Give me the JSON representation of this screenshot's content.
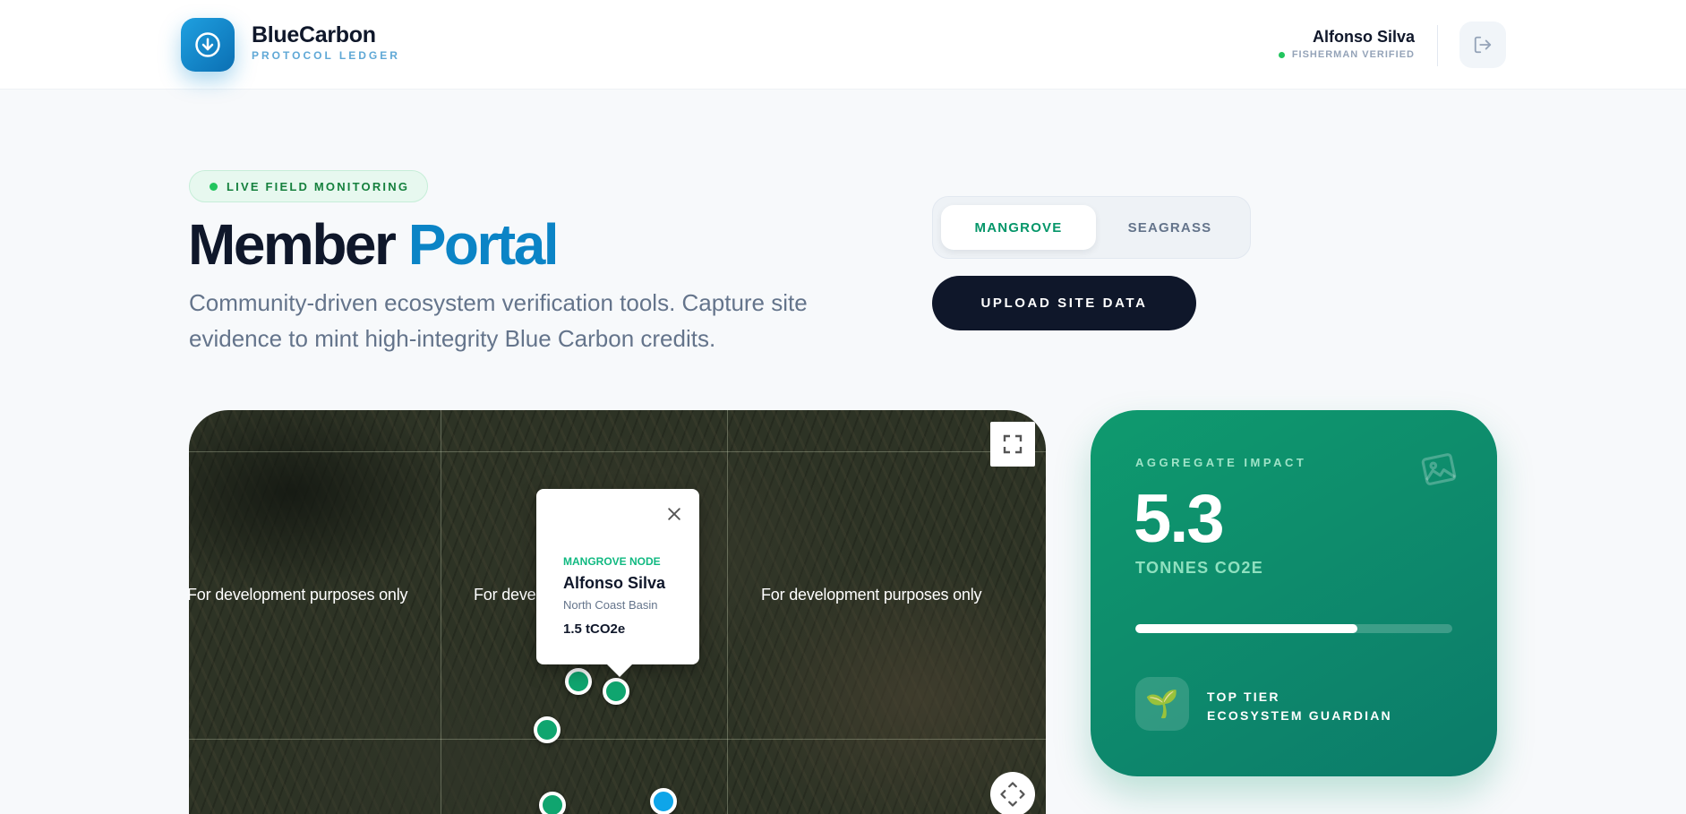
{
  "header": {
    "brand_name": "BlueCarbon",
    "brand_sub": "PROTOCOL LEDGER",
    "user_name": "Alfonso Silva",
    "user_status": "FISHERMAN VERIFIED"
  },
  "hero": {
    "badge": "LIVE FIELD MONITORING",
    "title_main": "Member",
    "title_accent": "Portal",
    "description": "Community-driven ecosystem verification tools. Capture site evidence to mint high-integrity Blue Carbon credits."
  },
  "toggle": {
    "options": [
      "MANGROVE",
      "SEAGRASS"
    ],
    "selected": "MANGROVE"
  },
  "upload_button": "UPLOAD SITE DATA",
  "map": {
    "watermark": "For development purposes only",
    "popup": {
      "kicker": "MANGROVE NODE",
      "name": "Alfonso Silva",
      "location": "North Coast Basin",
      "value": "1.5 tCO2e"
    }
  },
  "impact": {
    "kicker": "AGGREGATE IMPACT",
    "value": "5.3",
    "unit": "TONNES CO2E",
    "progress": 0.7,
    "tier_line1": "TOP TIER",
    "tier_line2": "ECOSYSTEM GUARDIAN",
    "tier_icon": "🌱"
  },
  "colors": {
    "brand_blue": "#0b84c6",
    "accent_green": "#10b981",
    "dark_navy": "#0f172a"
  }
}
